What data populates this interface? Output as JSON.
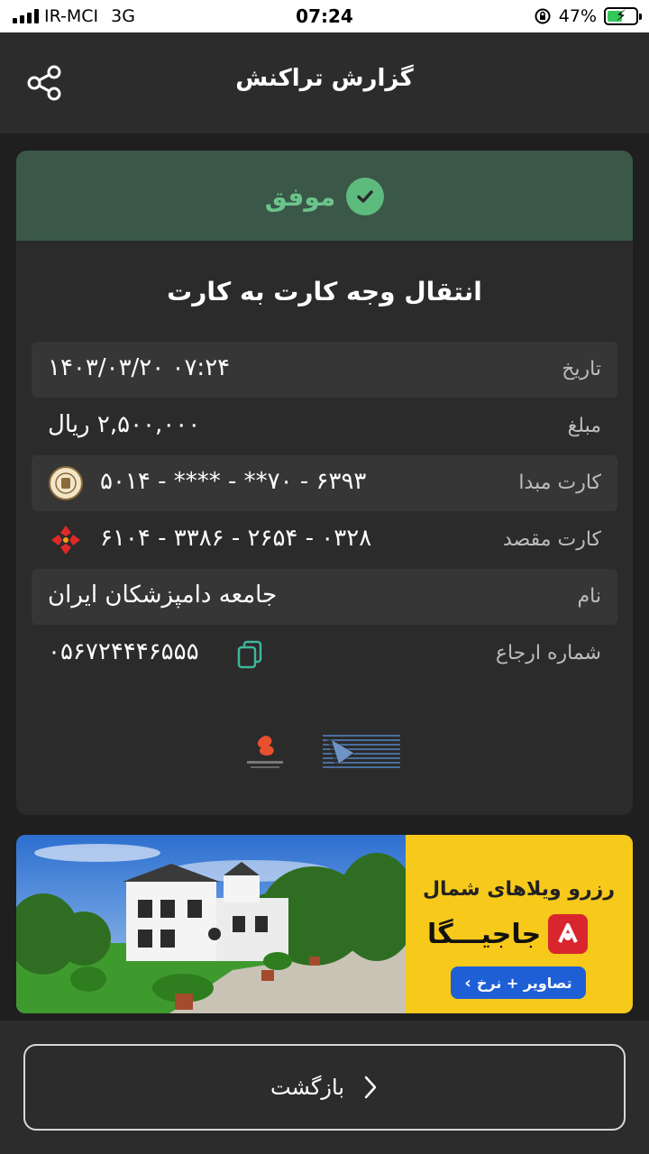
{
  "status_bar": {
    "carrier": "IR-MCI",
    "network": "3G",
    "time": "07:24",
    "battery": "47%"
  },
  "header": {
    "title": "گزارش تراکنش",
    "share_icon": "share-icon"
  },
  "receipt": {
    "status": "موفق",
    "status_color": "#6bc48b",
    "title": "انتقال وجه کارت به کارت",
    "rows": [
      {
        "label": "تاریخ",
        "value": "۱۴۰۳/۰۳/۲۰ ۰۷:۲۴"
      },
      {
        "label": "مبلغ",
        "value": "۲,۵۰۰,۰۰۰ ریال"
      },
      {
        "label": "کارت مبدا",
        "value": "۵۰۱۴ - **** - **۷۰ - ۶۳۹۳"
      },
      {
        "label": "کارت مقصد",
        "value": "۶۱۰۴ - ۳۳۸۶ - ۲۶۵۴ - ۰۳۲۸"
      },
      {
        "label": "نام",
        "value": "جامعه دامپزشکان ایران"
      },
      {
        "label": "شماره ارجاع",
        "value": "۰۵۶۷۲۴۴۴۶۵۵۵"
      }
    ]
  },
  "ad": {
    "headline": "رزرو ویلاهای شمال",
    "brand": "جاجیـــگا",
    "cta": "تصاویر + نرخ",
    "accent": "#f7c91b"
  },
  "footer": {
    "back_label": "بازگشت"
  }
}
